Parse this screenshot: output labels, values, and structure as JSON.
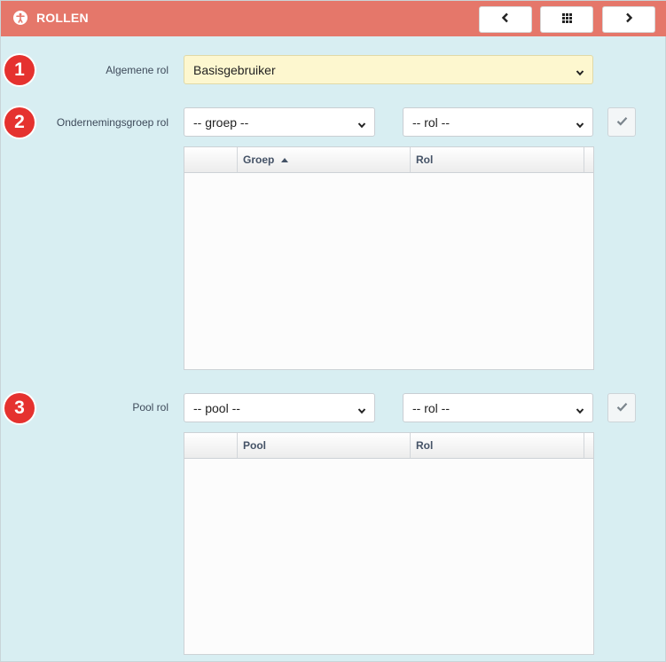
{
  "header": {
    "title": "ROLLEN",
    "title_icon": "person-circle-icon",
    "buttons": {
      "prev_icon": "chevron-left-icon",
      "grid_icon": "grid-icon",
      "next_icon": "chevron-right-icon"
    },
    "color": "#e5776a"
  },
  "badges": [
    "1",
    "2",
    "3"
  ],
  "general_role": {
    "label": "Algemene rol",
    "value": "Basisgebruiker"
  },
  "group_role": {
    "label": "Ondernemingsgroep rol",
    "group_select": "-- groep --",
    "role_select": "-- rol --",
    "confirm_icon": "check-icon",
    "table": {
      "columns": [
        "",
        "Groep",
        "Rol"
      ],
      "sorted_column": "Groep",
      "rows": []
    }
  },
  "pool_role": {
    "label": "Pool rol",
    "pool_select": "-- pool --",
    "role_select": "-- rol --",
    "confirm_icon": "check-icon",
    "table": {
      "columns": [
        "",
        "Pool",
        "Rol"
      ],
      "rows": []
    }
  },
  "colors": {
    "background": "#d8eef2",
    "badge": "#e5322f",
    "highlight_select": "#fdf7cf"
  }
}
